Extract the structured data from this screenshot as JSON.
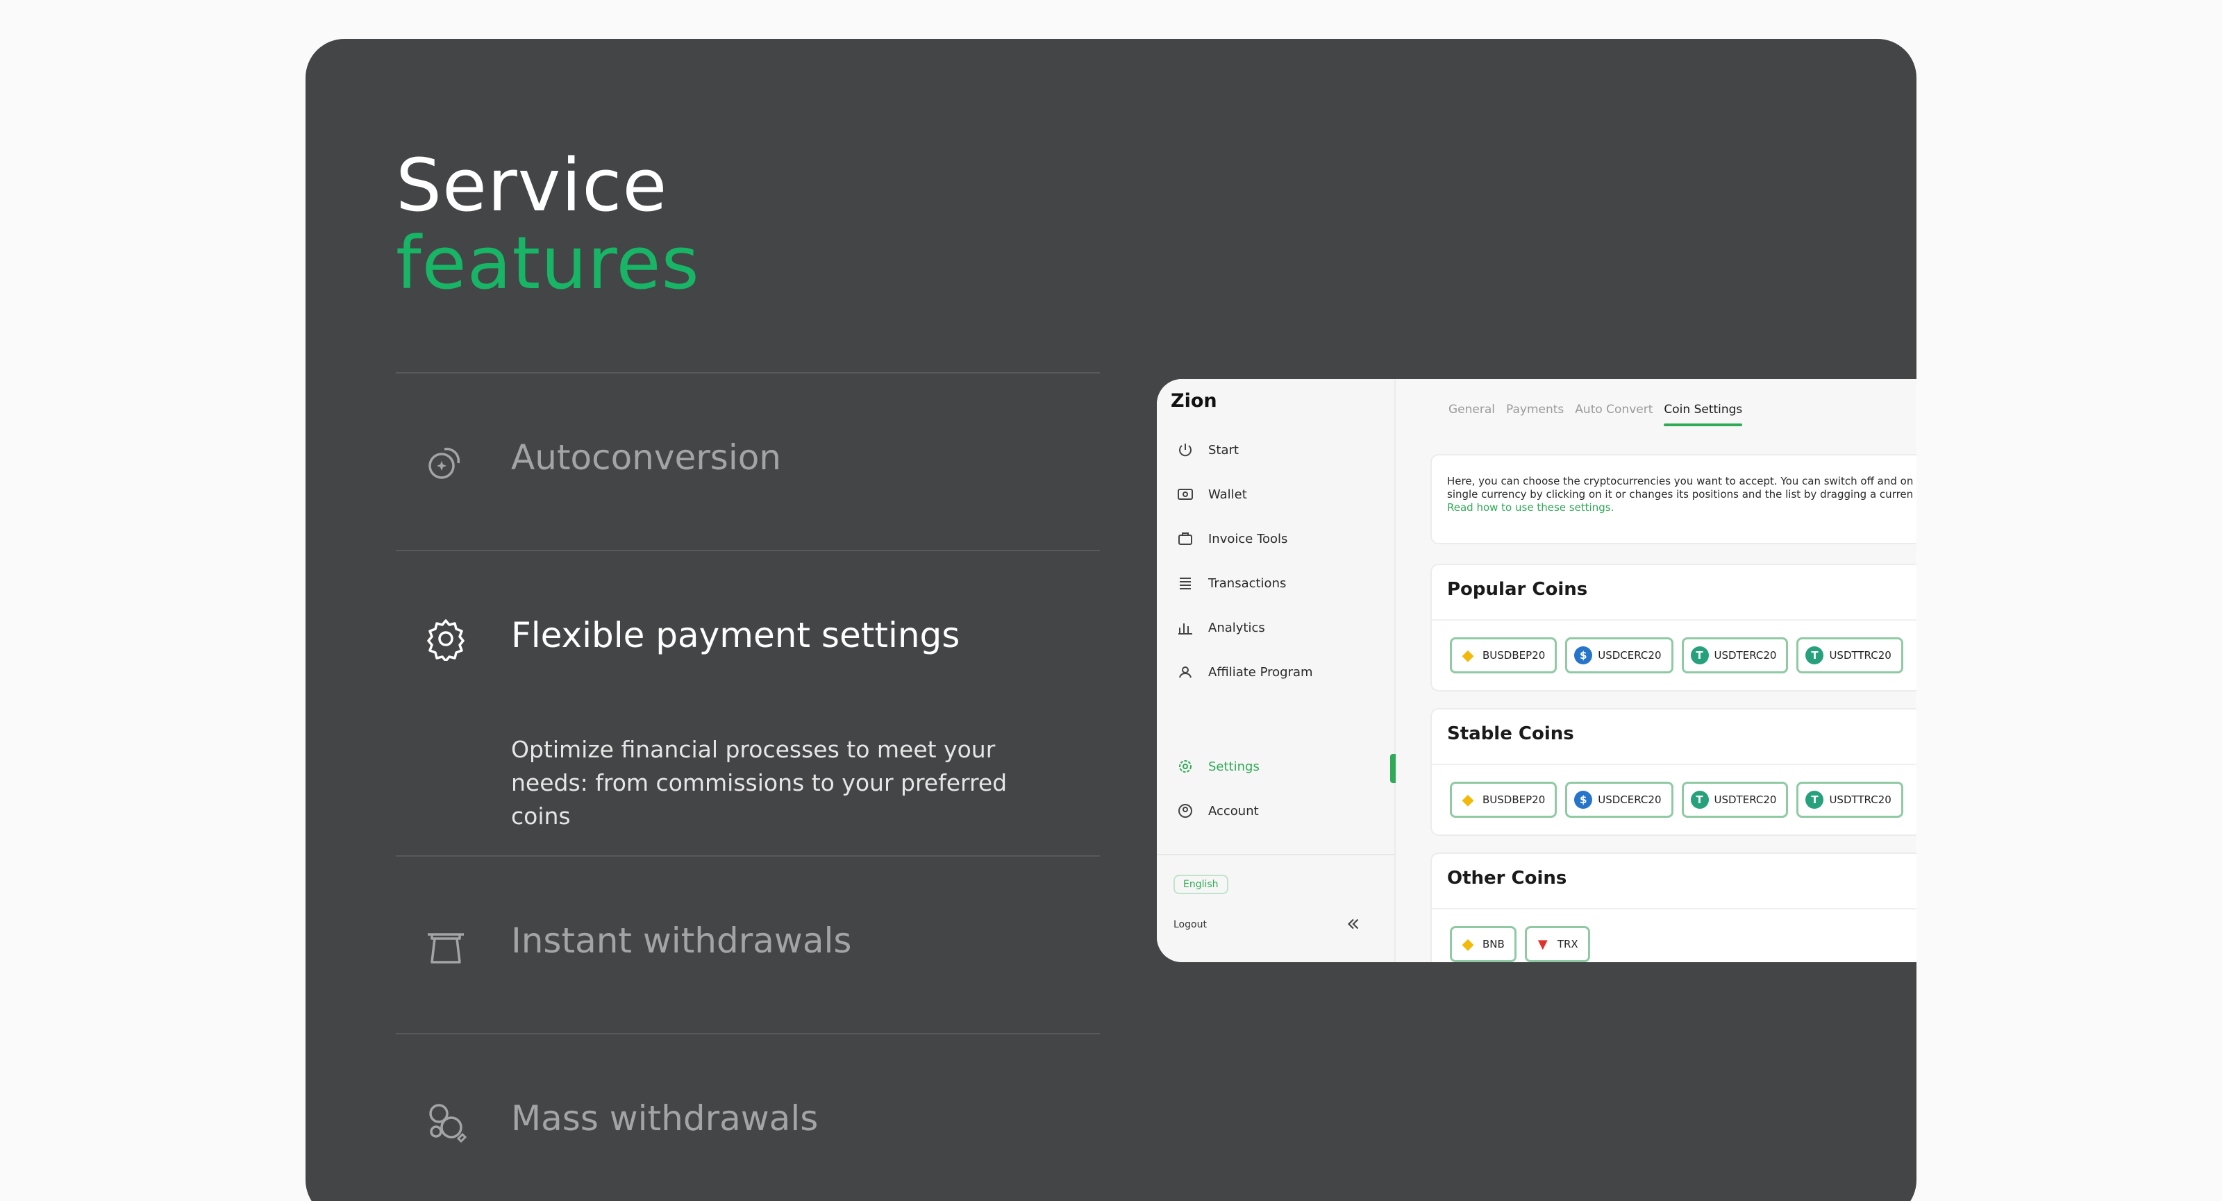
{
  "heading": {
    "line1": "Service",
    "line2": "features"
  },
  "colors": {
    "accent": "#17b565",
    "card": "#444547",
    "app_accent": "#2faa56"
  },
  "features": [
    {
      "title": "Autoconversion",
      "icon": "autoconversion-icon",
      "state": "collapsed"
    },
    {
      "title": "Flexible payment settings",
      "icon": "gear-icon",
      "state": "expanded",
      "description": "Optimize financial processes to meet your needs: from commissions to your preferred coins"
    },
    {
      "title": "Instant withdrawals",
      "icon": "withdrawal-icon",
      "state": "collapsed"
    },
    {
      "title": "Mass withdrawals",
      "icon": "mass-withdrawal-icon",
      "state": "collapsed"
    }
  ],
  "app": {
    "logo": "Zion",
    "nav": [
      {
        "label": "Start",
        "icon": "power-icon"
      },
      {
        "label": "Wallet",
        "icon": "wallet-icon"
      },
      {
        "label": "Invoice Tools",
        "icon": "invoice-icon"
      },
      {
        "label": "Transactions",
        "icon": "transactions-icon"
      },
      {
        "label": "Analytics",
        "icon": "analytics-icon"
      },
      {
        "label": "Affiliate Program",
        "icon": "affiliate-icon"
      },
      {
        "label": "Settings",
        "icon": "settings-icon",
        "active": true
      },
      {
        "label": "Account",
        "icon": "account-icon"
      }
    ],
    "language": "English",
    "logout": "Logout",
    "tabs": [
      {
        "label": "General"
      },
      {
        "label": "Payments"
      },
      {
        "label": "Auto Convert"
      },
      {
        "label": "Coin Settings",
        "active": true
      }
    ],
    "intro": {
      "line1": "Here, you can choose the cryptocurrencies you want to accept. You can switch off and on",
      "line2": "single currency by clicking on it or changes its positions and the list by dragging a curren",
      "link": "Read how to use these settings."
    },
    "sections": [
      {
        "title": "Popular Coins",
        "coins": [
          "BUSDBEP20",
          "USDCERC20",
          "USDTERC20",
          "USDTTRC20"
        ]
      },
      {
        "title": "Stable Coins",
        "coins": [
          "BUSDBEP20",
          "USDCERC20",
          "USDTERC20",
          "USDTTRC20"
        ]
      },
      {
        "title": "Other Coins",
        "coins": [
          "BNB",
          "TRX"
        ]
      }
    ]
  }
}
